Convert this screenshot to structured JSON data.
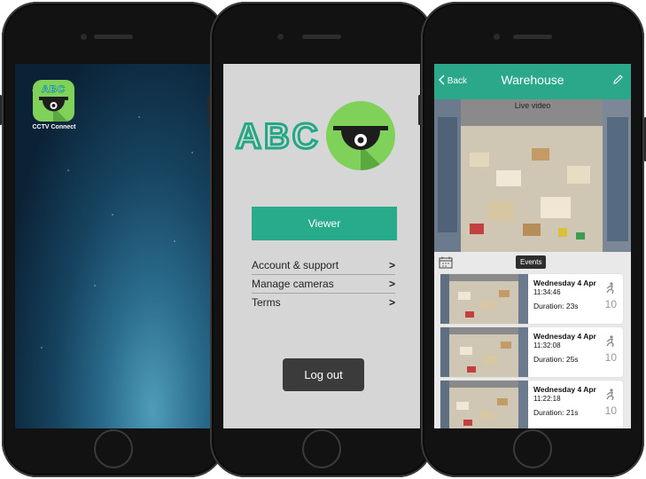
{
  "phone1": {
    "app_icon_text": "ABC",
    "app_label": "CCTV Connect"
  },
  "phone2": {
    "logo_text": "ABC",
    "viewer_label": "Viewer",
    "menu_items": [
      {
        "label": "Account & support",
        "chevron": ">"
      },
      {
        "label": "Manage cameras",
        "chevron": ">"
      },
      {
        "label": "Terms",
        "chevron": ">"
      }
    ],
    "logout_label": "Log out"
  },
  "phone3": {
    "back_label": "Back",
    "title": "Warehouse",
    "live_label": "Live video",
    "events_label": "Events",
    "events": [
      {
        "day": "Wednesday 4 Apr",
        "time": "11:34:46",
        "duration": "Duration: 23s",
        "count": "10"
      },
      {
        "day": "Wednesday 4 Apr",
        "time": "11:32:08",
        "duration": "Duration: 25s",
        "count": "10"
      },
      {
        "day": "Wednesday 4 Apr",
        "time": "11:22:18",
        "duration": "Duration: 21s",
        "count": "10"
      }
    ]
  },
  "colors": {
    "brand_green": "#28ab8a",
    "logo_lime": "#7fd15a",
    "logout_dark": "#3b3b3b"
  }
}
